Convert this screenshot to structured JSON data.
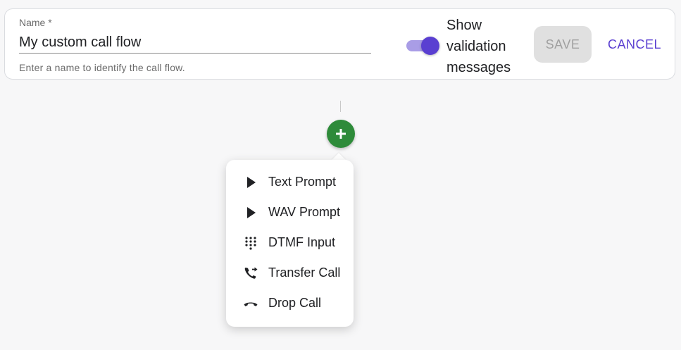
{
  "form": {
    "name_label": "Name *",
    "name_value": "My custom call flow",
    "name_helper": "Enter a name to identify the call flow.",
    "toggle_label": "Show validation messages",
    "toggle_on": true,
    "save_label": "SAVE",
    "cancel_label": "CANCEL"
  },
  "flow": {
    "add_icon": "plus-icon"
  },
  "menu": {
    "items": [
      {
        "label": "Text Prompt",
        "icon": "play-icon"
      },
      {
        "label": "WAV Prompt",
        "icon": "play-icon"
      },
      {
        "label": "DTMF Input",
        "icon": "dialpad-icon"
      },
      {
        "label": "Transfer Call",
        "icon": "phone-forward-icon"
      },
      {
        "label": "Drop Call",
        "icon": "call-end-icon"
      }
    ]
  },
  "colors": {
    "accent": "#5a3fd1",
    "toggle_track": "#a99de6",
    "add_button": "#2e8b3a",
    "save_disabled_bg": "#e0e0e0"
  }
}
